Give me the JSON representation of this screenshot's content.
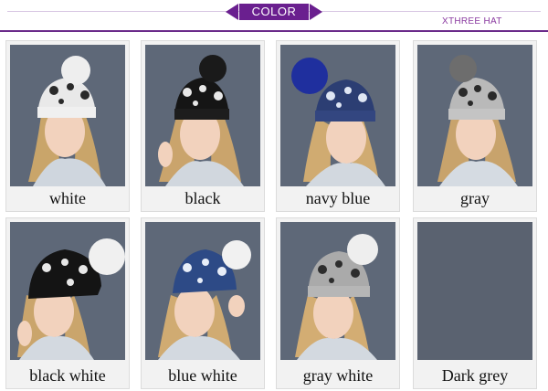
{
  "header": {
    "banner_label": "COLOR",
    "brand": "XTHREE HAT"
  },
  "colors": {
    "banner": "#6a1f8f",
    "rule": "#6a2a8a"
  },
  "products": [
    {
      "label": "white",
      "hat_color": "#e9e9e9",
      "pattern_color": "#2a2a2a",
      "pom_color": "#eeeeee"
    },
    {
      "label": "black",
      "hat_color": "#151515",
      "pattern_color": "#e8e8e8",
      "pom_color": "#1a1a1a"
    },
    {
      "label": "navy blue",
      "hat_color": "#2c3e73",
      "pattern_color": "#dfe6f4",
      "pom_color": "#1f2f9e"
    },
    {
      "label": "gray",
      "hat_color": "#b9b9b9",
      "pattern_color": "#2a2a2a",
      "pom_color": "#6d6d6d"
    },
    {
      "label": "black white",
      "hat_color": "#141414",
      "pattern_color": "#e8e8e8",
      "pom_color": "#f0f0f0"
    },
    {
      "label": "blue white",
      "hat_color": "#2d4a86",
      "pattern_color": "#e8eef8",
      "pom_color": "#f1f1f1"
    },
    {
      "label": "gray white",
      "hat_color": "#aaaaaa",
      "pattern_color": "#2d2d2d",
      "pom_color": "#eeeeee"
    },
    {
      "label": "Dark grey",
      "hat_color": "#5a6270",
      "pattern_color": "#5a6270",
      "pom_color": "#5a6270"
    }
  ]
}
